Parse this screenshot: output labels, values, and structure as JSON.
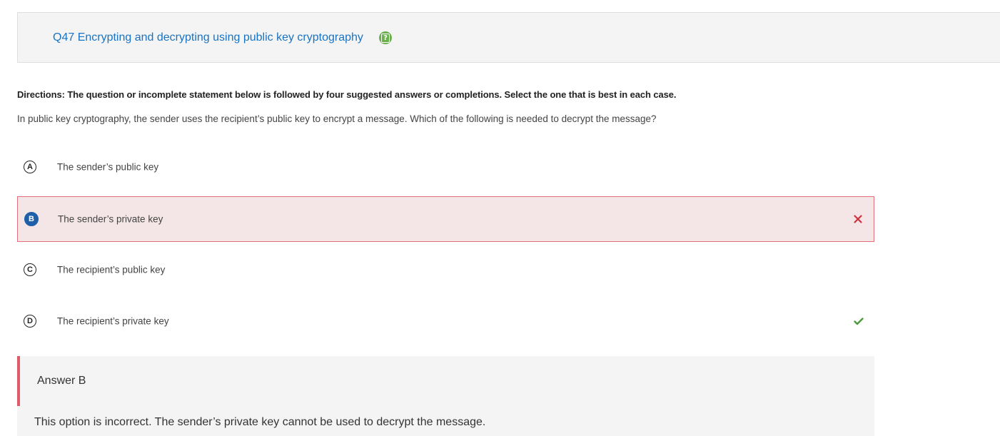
{
  "question": {
    "title": "Q47 Encrypting and decrypting using public key cryptography",
    "help_icon": "help-icon",
    "directions": "Directions: The question or incomplete statement below is followed by four suggested answers or completions. Select the one that is best in each case.",
    "text": "In public key cryptography, the sender uses the recipient’s public key to encrypt a message. Which of the following is needed to decrypt the message?"
  },
  "options": [
    {
      "letter": "A",
      "text": "The sender’s public key",
      "state": "none"
    },
    {
      "letter": "B",
      "text": "The sender’s private key",
      "state": "selected-incorrect"
    },
    {
      "letter": "C",
      "text": "The recipient’s public key",
      "state": "none"
    },
    {
      "letter": "D",
      "text": "The recipient’s private key",
      "state": "correct"
    }
  ],
  "feedback": {
    "title": "Answer B",
    "text": "This option is incorrect. The sender’s private key cannot be used to decrypt the message."
  },
  "colors": {
    "title_link": "#1a73c2",
    "help_icon": "#6ab04c",
    "incorrect": "#d0303f",
    "correct": "#4a9a3a",
    "selected_letter": "#1e5fa8",
    "selected_bg": "#f4e6e6",
    "feedback_bar": "#e05a6a"
  }
}
